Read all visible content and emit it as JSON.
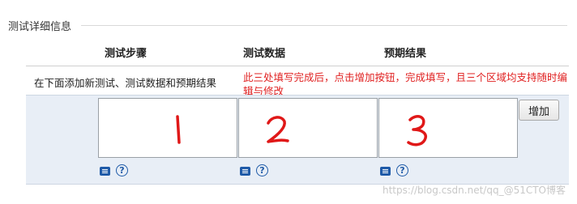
{
  "section": {
    "title": "测试详细信息"
  },
  "columns": {
    "steps": "测试步骤",
    "data": "测试数据",
    "expected": "预期结果"
  },
  "hint": "在下面添加新测试、测试数据和预期结果",
  "note": "此三处填写完成后，点击增加按钮，完成填写，且三个区域均支持随时编辑与修改",
  "boxes": [
    {
      "handwritten": "1"
    },
    {
      "handwritten": "2"
    },
    {
      "handwritten": "3"
    }
  ],
  "add_button": "增加",
  "icons": {
    "format": "document-icon",
    "help": "help-icon"
  },
  "help_glyph": "?",
  "watermark": "https://blog.csdn.net/qq_@51CTO博客",
  "colors": {
    "note": "#e02020",
    "band": "#e8eef6",
    "icon": "#1e5aa8"
  }
}
